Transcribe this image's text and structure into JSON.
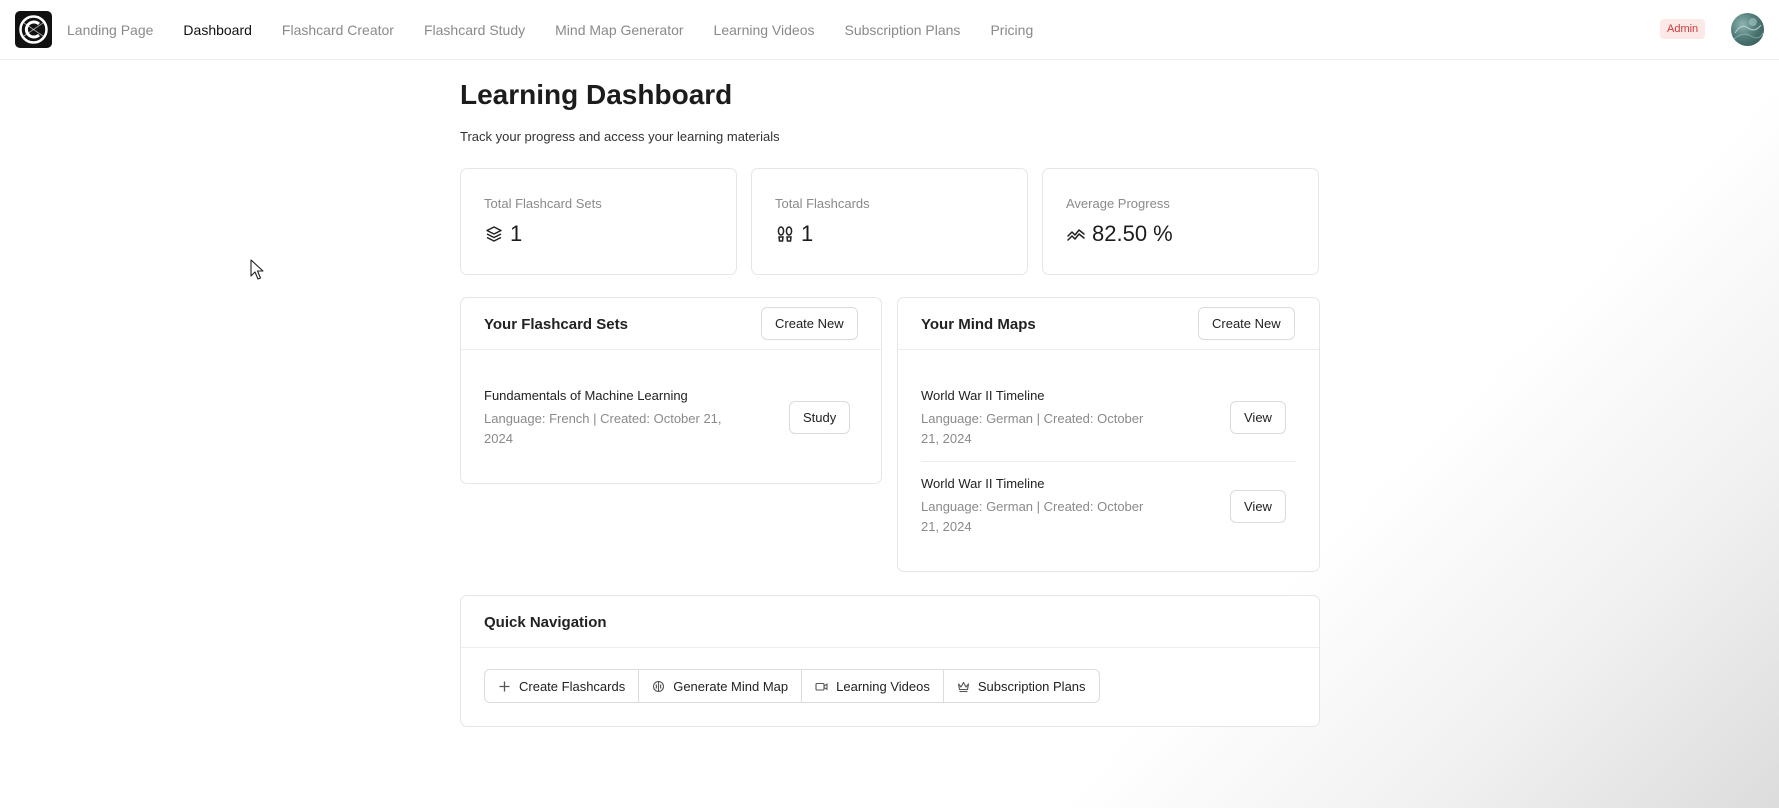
{
  "header": {
    "nav": [
      {
        "label": "Landing Page",
        "active": false
      },
      {
        "label": "Dashboard",
        "active": true
      },
      {
        "label": "Flashcard Creator",
        "active": false
      },
      {
        "label": "Flashcard Study",
        "active": false
      },
      {
        "label": "Mind Map Generator",
        "active": false
      },
      {
        "label": "Learning Videos",
        "active": false
      },
      {
        "label": "Subscription Plans",
        "active": false
      },
      {
        "label": "Pricing",
        "active": false
      }
    ],
    "admin_badge": "Admin",
    "logo_icon": "app-logo",
    "avatar_icon": "user-avatar"
  },
  "page": {
    "title": "Learning Dashboard",
    "subtitle": "Track your progress and access your learning materials"
  },
  "stats": [
    {
      "label": "Total Flashcard Sets",
      "value": "1",
      "icon": "layers-icon"
    },
    {
      "label": "Total Flashcards",
      "value": "1",
      "icon": "footprints-icon"
    },
    {
      "label": "Average Progress",
      "value": "82.50 %",
      "icon": "activity-icon"
    }
  ],
  "flashcard_sets": {
    "title": "Your Flashcard Sets",
    "create_label": "Create New",
    "items": [
      {
        "title": "Fundamentals of Machine Learning",
        "meta": "Language: French | Created: October 21, 2024",
        "action": "Study"
      }
    ]
  },
  "mind_maps": {
    "title": "Your Mind Maps",
    "create_label": "Create New",
    "items": [
      {
        "title": "World War II Timeline",
        "meta": "Language: German | Created: October 21, 2024",
        "action": "View"
      },
      {
        "title": "World War II Timeline",
        "meta": "Language: German | Created: October 21, 2024",
        "action": "View"
      }
    ]
  },
  "quick_nav": {
    "title": "Quick Navigation",
    "buttons": [
      {
        "label": "Create Flashcards",
        "icon": "plus-icon"
      },
      {
        "label": "Generate Mind Map",
        "icon": "brain-icon"
      },
      {
        "label": "Learning Videos",
        "icon": "video-icon"
      },
      {
        "label": "Subscription Plans",
        "icon": "crown-icon"
      }
    ]
  },
  "colors": {
    "admin_badge_bg": "#fde8e8",
    "admin_badge_text": "#d03a3a",
    "muted_text": "#8a8a8a",
    "border": "#e6e6e6"
  }
}
